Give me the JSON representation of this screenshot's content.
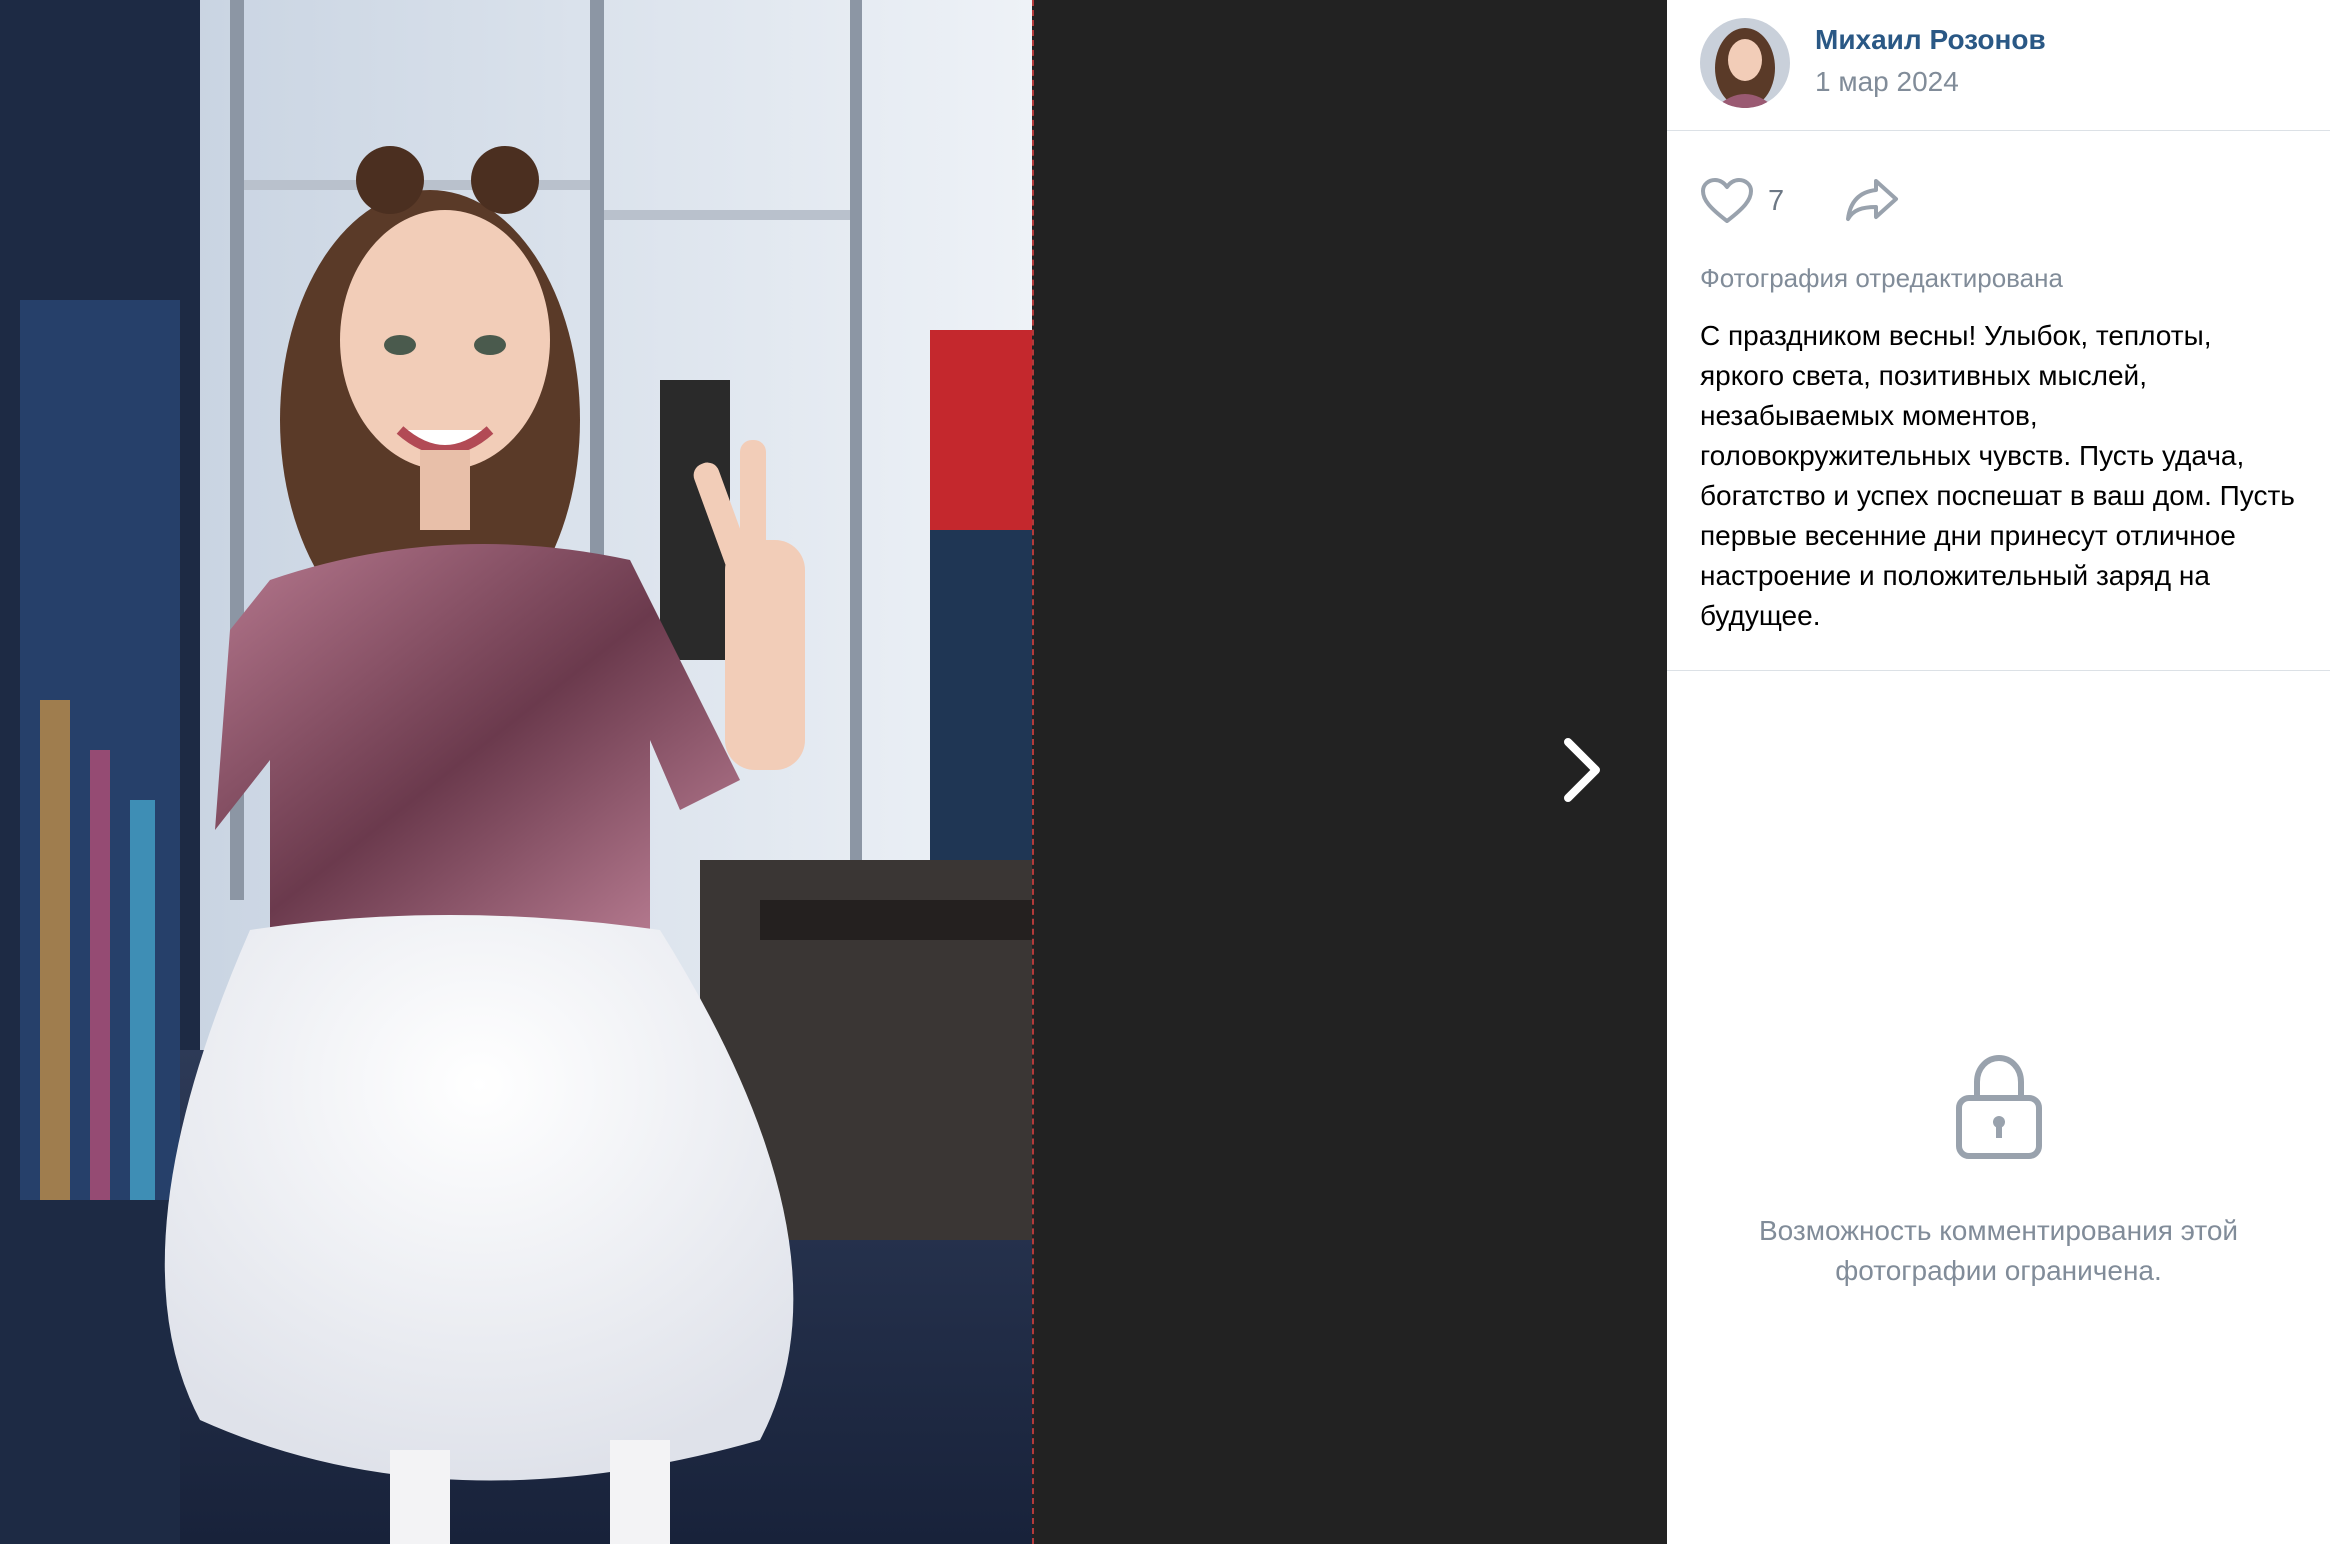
{
  "post": {
    "author_name": "Михаил Розонов",
    "date": "1 мар 2024",
    "avatar_icon": "avatar-photo"
  },
  "actions": {
    "like_count": "7",
    "like_icon": "heart-icon",
    "share_icon": "share-arrow-icon"
  },
  "photo": {
    "edited_note": "Фотография отредактирована",
    "caption": "С праздником весны! Улыбок, теплоты, яркого света, позитивных мыслей, незабываемых моментов, головокружительных чувств. Пусть удача, богатство и успех поспешат в ваш дом. Пусть первые весенние дни принесут отличное настроение и положительный заряд на будущее."
  },
  "viewer": {
    "next_icon": "chevron-right-icon"
  },
  "comments": {
    "locked_text": "Возможность комментирования этой фотографии ограничена.",
    "lock_icon": "lock-icon"
  },
  "colors": {
    "link": "#2a5885",
    "secondary_text": "#818c99",
    "stage_bg": "#222222",
    "divider": "#dce1e6",
    "icon_gray": "#99a2ad"
  }
}
